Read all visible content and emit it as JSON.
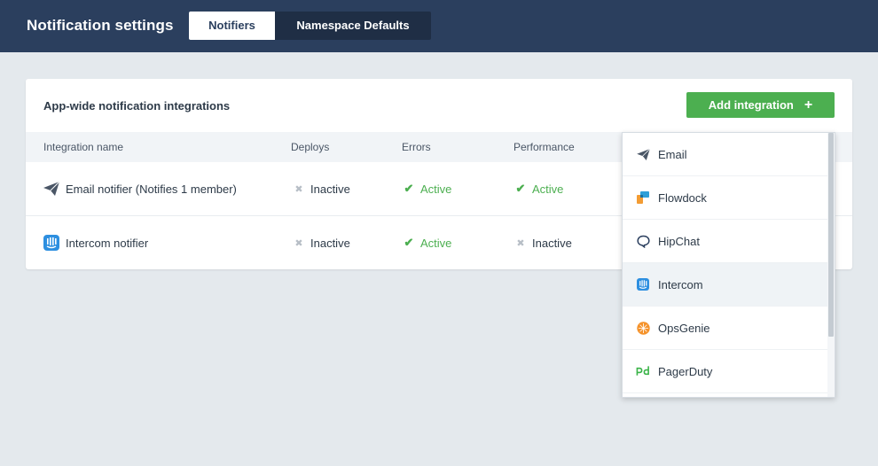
{
  "header": {
    "title": "Notification settings",
    "tabs": [
      {
        "label": "Notifiers",
        "active": true
      },
      {
        "label": "Namespace Defaults",
        "active": false
      }
    ]
  },
  "card": {
    "title": "App-wide notification integrations",
    "add_button_label": "Add integration",
    "columns": [
      "Integration name",
      "Deploys",
      "Errors",
      "Performance"
    ],
    "rows": [
      {
        "name": "Email notifier (Notifies 1 member)",
        "icon": "paper-plane-icon",
        "deploys": "Inactive",
        "errors": "Active",
        "performance": "Active"
      },
      {
        "name": "Intercom notifier",
        "icon": "intercom-icon",
        "deploys": "Inactive",
        "errors": "Active",
        "performance": "Inactive"
      }
    ]
  },
  "dropdown": {
    "items": [
      {
        "label": "Email",
        "icon": "paper-plane-icon"
      },
      {
        "label": "Flowdock",
        "icon": "flowdock-icon"
      },
      {
        "label": "HipChat",
        "icon": "hipchat-icon"
      },
      {
        "label": "Intercom",
        "icon": "intercom-icon"
      },
      {
        "label": "OpsGenie",
        "icon": "opsgenie-icon"
      },
      {
        "label": "PagerDuty",
        "icon": "pagerduty-icon"
      }
    ],
    "hovered_index": 3
  },
  "colors": {
    "topbar": "#2b3f5e",
    "accent_green": "#4caf50",
    "background": "#e4e9ed"
  }
}
